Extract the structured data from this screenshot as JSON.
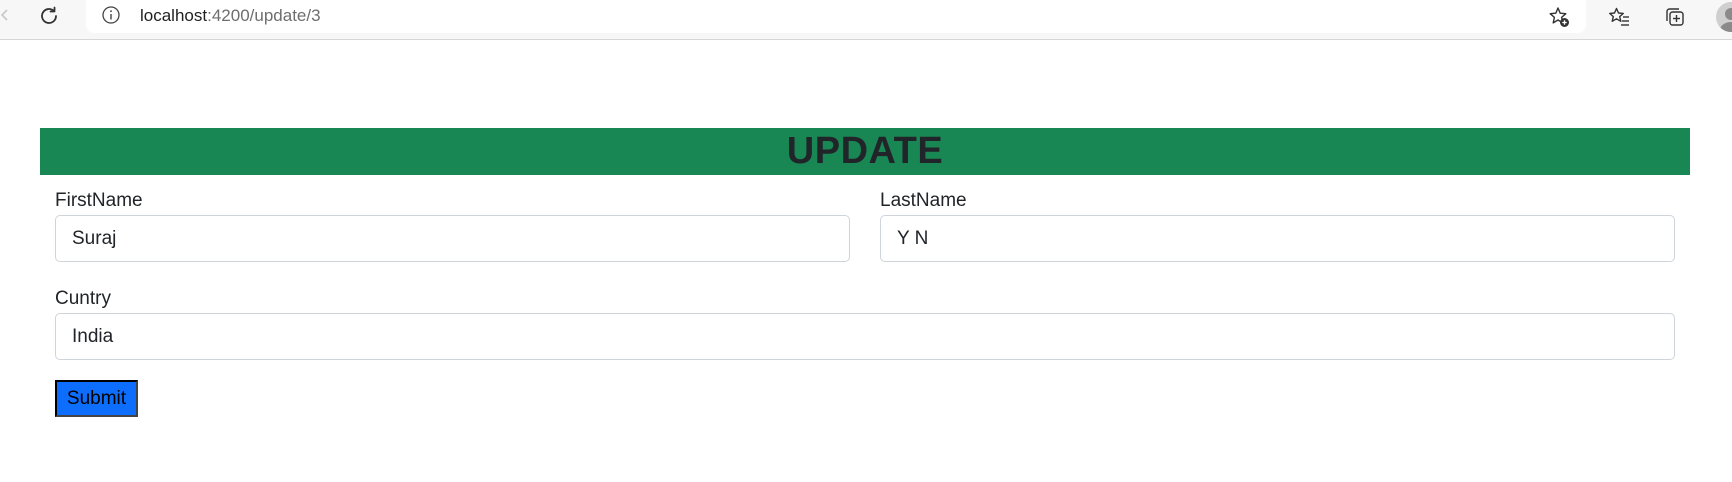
{
  "browser": {
    "url_host": "localhost",
    "url_path": ":4200/update/3",
    "icons": {
      "reload": "reload-icon",
      "info": "info-icon",
      "star_add": "star-add-icon",
      "favorites": "favorites-icon",
      "collections": "collections-icon",
      "profile": "profile-avatar"
    }
  },
  "page": {
    "title": "UPDATE",
    "banner_color": "#198754",
    "form": {
      "first_name_label": "FirstName",
      "first_name_value": "Suraj",
      "last_name_label": "LastName",
      "last_name_value": "Y N",
      "country_label": "Cuntry",
      "country_value": "India",
      "submit_label": "Submit",
      "submit_color": "#0d6efd"
    }
  }
}
